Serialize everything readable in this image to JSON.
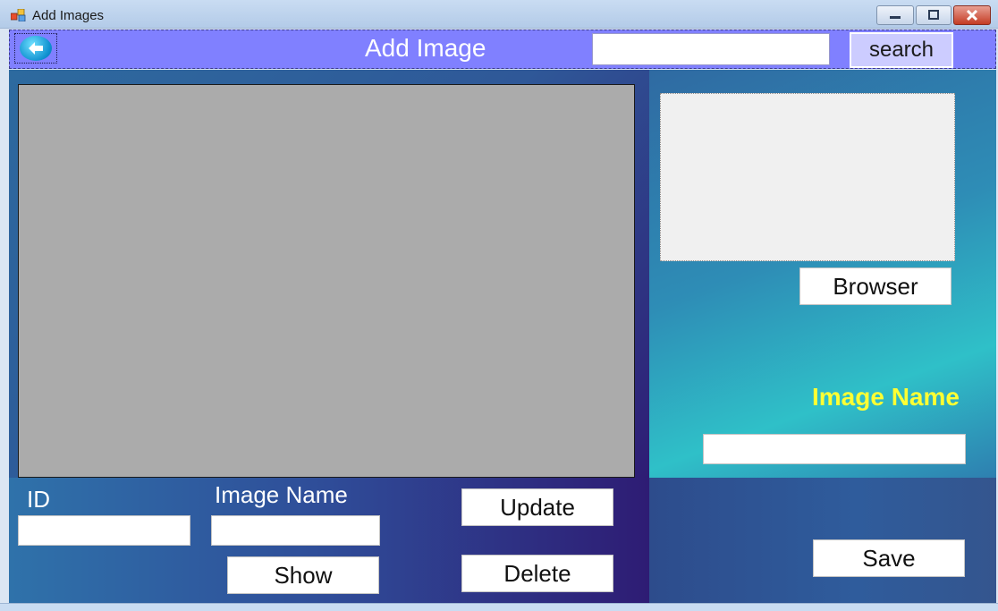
{
  "window": {
    "title": "Add Images",
    "icons": {
      "app": "app-icon",
      "minimize": "minimize-icon",
      "maximize": "maximize-icon",
      "close": "close-icon"
    }
  },
  "header": {
    "title": "Add Image",
    "search_value": "",
    "search_label": "search",
    "back_icon": "arrow-left-icon",
    "bg_color": "#8080ff"
  },
  "preview": {
    "browse_label": "Browser",
    "image_name_label": "Image Name",
    "image_name_value": "",
    "save_label": "Save",
    "label_color": "#ffff33"
  },
  "form": {
    "id_label": "ID",
    "id_value": "",
    "name_label": "Image Name",
    "name_value": "",
    "show_label": "Show",
    "update_label": "Update",
    "delete_label": "Delete"
  }
}
